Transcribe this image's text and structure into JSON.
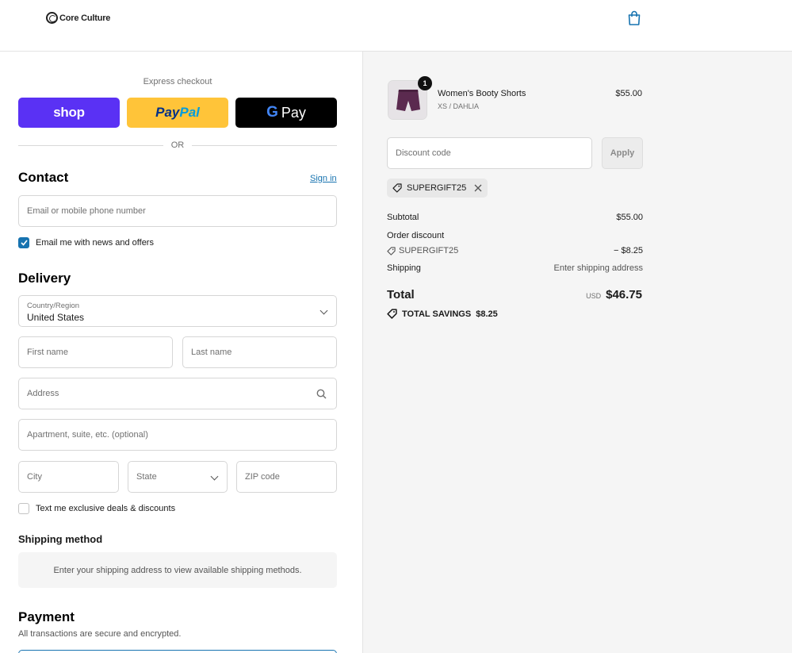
{
  "header": {
    "logo_text": "Core Culture",
    "cart_icon": "shopping-bag-icon",
    "accent": "#1773b0"
  },
  "express": {
    "label": "Express checkout",
    "shop_label": "shop",
    "paypal_label_1": "Pay",
    "paypal_label_2": "Pal",
    "gpay_g": "G",
    "gpay_label": "Pay",
    "or_label": "OR",
    "colors": {
      "shop": "#5a31f4",
      "paypal": "#ffc439",
      "gpay": "#000000"
    }
  },
  "contact": {
    "title": "Contact",
    "sign_in": "Sign in",
    "email_placeholder": "Email or mobile phone number",
    "newsletter_label": "Email me with news and offers",
    "newsletter_checked": true
  },
  "delivery": {
    "title": "Delivery",
    "country_label": "Country/Region",
    "country_value": "United States",
    "first_name": "First name",
    "last_name": "Last name",
    "address": "Address",
    "apartment": "Apartment, suite, etc. (optional)",
    "city": "City",
    "state": "State",
    "zip": "ZIP code",
    "sms_label": "Text me exclusive deals & discounts",
    "sms_checked": false
  },
  "shipping_method": {
    "title": "Shipping method",
    "message": "Enter your shipping address to view available shipping methods."
  },
  "payment": {
    "title": "Payment",
    "subtitle": "All transactions are secure and encrypted."
  },
  "summary": {
    "item": {
      "name": "Women's Booty Shorts",
      "variant": "XS / DAHLIA",
      "price": "$55.00",
      "quantity": "1",
      "color": "#5b2a4f"
    },
    "discount_placeholder": "Discount code",
    "apply_label": "Apply",
    "applied_code": "SUPERGIFT25",
    "subtotal_label": "Subtotal",
    "subtotal_value": "$55.00",
    "order_discount_label": "Order discount",
    "discount_code": "SUPERGIFT25",
    "discount_value": "− $8.25",
    "shipping_label": "Shipping",
    "shipping_value": "Enter shipping address",
    "total_label": "Total",
    "total_currency": "USD",
    "total_value": "$46.75",
    "savings_label": "TOTAL SAVINGS",
    "savings_value": "$8.25"
  }
}
